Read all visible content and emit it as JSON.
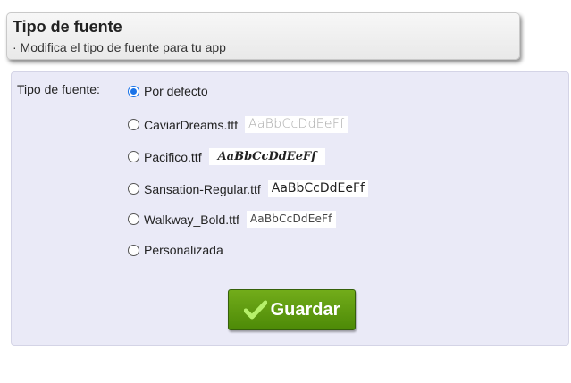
{
  "header": {
    "title": "Tipo de fuente",
    "subtitle": "· Modifica el tipo de fuente para tu app"
  },
  "form": {
    "label": "Tipo de fuente:",
    "options": [
      {
        "label": "Por defecto",
        "checked": true,
        "sample": ""
      },
      {
        "label": "CaviarDreams.ttf",
        "checked": false,
        "sample": "AaBbCcDdEeFf"
      },
      {
        "label": "Pacifico.ttf",
        "checked": false,
        "sample": "AaBbCcDdEeFf"
      },
      {
        "label": "Sansation-Regular.ttf",
        "checked": false,
        "sample": "AaBbCcDdEeFf"
      },
      {
        "label": "Walkway_Bold.ttf",
        "checked": false,
        "sample": "AaBbCcDdEeFf"
      },
      {
        "label": "Personalizada",
        "checked": false,
        "sample": ""
      }
    ],
    "save_label": "Guardar"
  },
  "colors": {
    "accent_radio": "#1a73e8",
    "save_button": "#5e9a0f",
    "panel_bg": "#eaeaf7"
  },
  "icons": {
    "save": "checkmark-icon"
  }
}
